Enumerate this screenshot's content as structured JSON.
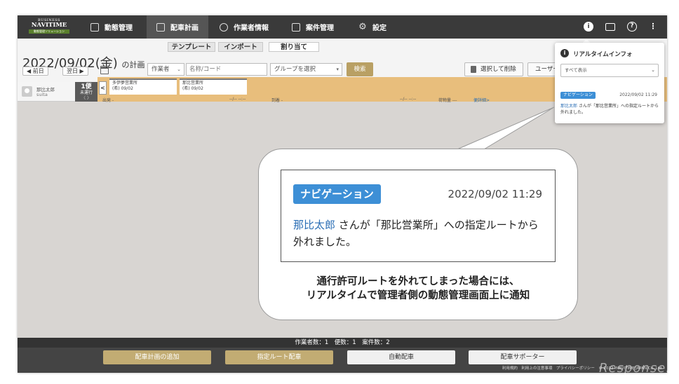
{
  "logo": {
    "line1": "BUSINESS",
    "line2": "NAVITIME",
    "line3": "動態管理ソリューション"
  },
  "nav": {
    "items": [
      {
        "label": "動態管理",
        "icon": "car-icon"
      },
      {
        "label": "配車計画",
        "icon": "calendar-list-icon",
        "active": true
      },
      {
        "label": "作業者情報",
        "icon": "person-icon"
      },
      {
        "label": "案件管理",
        "icon": "clipboard-icon"
      },
      {
        "label": "設定",
        "icon": "gear-icon"
      }
    ]
  },
  "topbar_icons": [
    "info-icon",
    "mail-icon",
    "help-icon",
    "more-icon"
  ],
  "subtabs": [
    {
      "label": "テンプレート"
    },
    {
      "label": "インポート"
    },
    {
      "label": "割り当て",
      "active": true
    }
  ],
  "plan": {
    "date": "2022/09/02(金)",
    "suffix": "の計画",
    "prev_day": "◀ 前日",
    "next_day": "翌日 ▶"
  },
  "filters": {
    "worker_select": "作業者",
    "name_placeholder": "名称/コード",
    "group_select": "グループを選択",
    "search": "検索"
  },
  "actions": {
    "delete_selected": "選択して削除",
    "user_button": "ユーザー"
  },
  "schedule": {
    "driver_name": "那比太郎",
    "driver_sub": "suita",
    "trip_number": "1便",
    "trip_status": "未運行",
    "trip_arrows": "〈 〉",
    "collapse": "<",
    "stops": [
      {
        "name": "多伊夢営業所",
        "date": "(希) 09/02"
      },
      {
        "name": "那比営業所",
        "date": "(希) 09/02"
      }
    ],
    "timeline": {
      "depart": "出発 -",
      "time1": "--/-- --:--",
      "arrive": "到着 -",
      "time2": "--/-- --:--",
      "cargo": "荷物量 ---",
      "detail_link": "便詳細>"
    }
  },
  "bottom": {
    "counts": "作業者数：1　便数：1　案件数：2",
    "buttons": [
      "配車計画の追加",
      "指定ルート配車",
      "自動配車",
      "配車サポーター"
    ],
    "footer": "利用規約　利用上の注意事項　プライバシーポリシー　© 2012- NAVITIME JAPAN Co.,Ltd."
  },
  "realtime_popup": {
    "title": "リアルタイムインフォ",
    "filter": "すべて表示",
    "badge": "ナビゲーション",
    "time": "2022/09/02 11:29",
    "driver": "那比太郎",
    "message": "さんが「那比営業所」への指定ルートから外れました。"
  },
  "callout": {
    "badge": "ナビゲーション",
    "time": "2022/09/02 11:29",
    "driver": "那比太郎",
    "message": "さんが「那比営業所」への指定ルートから外れました。",
    "caption_line1": "通行許可ルートを外れてしまった場合には、",
    "caption_line2": "リアルタイムで管理者側の動態管理画面上に通知"
  },
  "watermark": "Response."
}
